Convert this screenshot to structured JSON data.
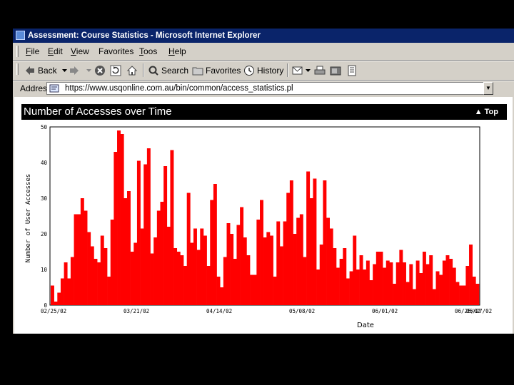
{
  "window": {
    "title": "Assessment: Course Statistics - Microsoft Internet Explorer"
  },
  "menu": [
    {
      "label": "File",
      "accel": "F",
      "rest": "ile"
    },
    {
      "label": "Edit",
      "accel": "E",
      "rest": "dit"
    },
    {
      "label": "View",
      "accel": "V",
      "rest": "iew"
    },
    {
      "label": "Favorites",
      "accel": "",
      "rest": "Favorites"
    },
    {
      "label": "Toos",
      "accel": "T",
      "rest": "oos"
    },
    {
      "label": "Help",
      "accel": "H",
      "rest": "elp"
    }
  ],
  "toolbar": {
    "back_label": "Back",
    "search_label": "Search",
    "favorites_label": "Favorites",
    "history_label": "History"
  },
  "address": {
    "label": "Address",
    "value": "https://www.usqonline.com.au/bin/common/access_statistics.pl"
  },
  "page": {
    "heading": "Number of Accesses over Time",
    "top_link": "▲  Top"
  },
  "colors": {
    "bar": "#ff0000",
    "titlebar": "#0a246a",
    "chrome": "#d4d0c8"
  },
  "chart_data": {
    "type": "bar",
    "title": "Number of Accesses over Time",
    "xlabel": "Date",
    "ylabel": "Number of User Accesses",
    "ylim": [
      0,
      50
    ],
    "yticks": [
      "50",
      "40",
      "30",
      "20",
      "10",
      "0"
    ],
    "xticks": [
      "02/25/02",
      "03/21/02",
      "04/14/02",
      "05/08/02",
      "06/01/02",
      "06/25/02",
      "06/27/02"
    ],
    "grid": false,
    "values": [
      5.5,
      1,
      3.5,
      7.5,
      12,
      7.5,
      13.5,
      25.5,
      25.5,
      30,
      26.5,
      20.5,
      16.5,
      13,
      12,
      19.5,
      16,
      8,
      24,
      43,
      49,
      48,
      30,
      32,
      15,
      17.5,
      40.5,
      21.5,
      39.5,
      44,
      14.5,
      19,
      26.5,
      29,
      39,
      22,
      43.5,
      16,
      15,
      14,
      11,
      31.5,
      17.5,
      21.5,
      15.5,
      21.5,
      19.5,
      11,
      29.5,
      34,
      8,
      5,
      13.5,
      23,
      20,
      13,
      22.5,
      27.5,
      19,
      14,
      8.5,
      8.5,
      24,
      29.5,
      19,
      20.5,
      19.5,
      8,
      23.5,
      16.5,
      23.5,
      31.5,
      35,
      20,
      24.5,
      25.5,
      13.5,
      37.5,
      30,
      35.5,
      10,
      17,
      35,
      24.5,
      21.5,
      16,
      10.5,
      13,
      16,
      7.5,
      9.5,
      19.5,
      10,
      14,
      10,
      12.5,
      7,
      11.5,
      15,
      15,
      10.5,
      12.5,
      12,
      6,
      12,
      15.5,
      12,
      6.5,
      11.5,
      4.5,
      12.5,
      9,
      15,
      11.5,
      14,
      4.5,
      9.5,
      8.5,
      12.5,
      14,
      13,
      10.5,
      6.5,
      5.5,
      5.5,
      11,
      17,
      8,
      6
    ]
  }
}
